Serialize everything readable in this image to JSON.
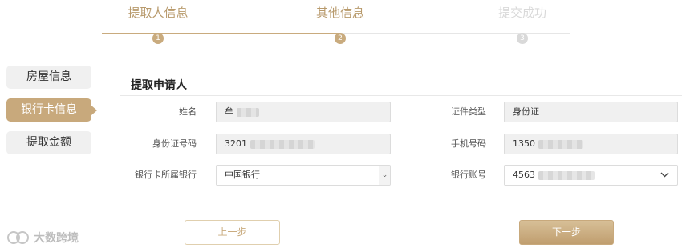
{
  "steps": [
    {
      "label": "提取人信息",
      "number": "1",
      "state": "done"
    },
    {
      "label": "其他信息",
      "number": "2",
      "state": "done"
    },
    {
      "label": "提交成功",
      "number": "3",
      "state": "todo"
    }
  ],
  "sidebar": {
    "items": [
      {
        "label": "房屋信息",
        "active": false
      },
      {
        "label": "银行卡信息",
        "active": true
      },
      {
        "label": "提取金额",
        "active": false
      }
    ]
  },
  "section": {
    "title": "提取申请人"
  },
  "form": {
    "name": {
      "label": "姓名",
      "value": "牟"
    },
    "id_type": {
      "label": "证件类型",
      "value": "身份证"
    },
    "id_number": {
      "label": "身份证号码",
      "value": "3201"
    },
    "phone": {
      "label": "手机号码",
      "value": "1350"
    },
    "bank": {
      "label": "银行卡所属银行",
      "value": "中国银行"
    },
    "account": {
      "label": "银行账号",
      "value": "4563"
    }
  },
  "buttons": {
    "prev": "上一步",
    "next": "下一步"
  },
  "watermark": {
    "text": "大数跨境"
  },
  "colors": {
    "accent": "#c8a97c",
    "inactive": "#d9d9d9",
    "field_bg": "#f0f0f0"
  }
}
